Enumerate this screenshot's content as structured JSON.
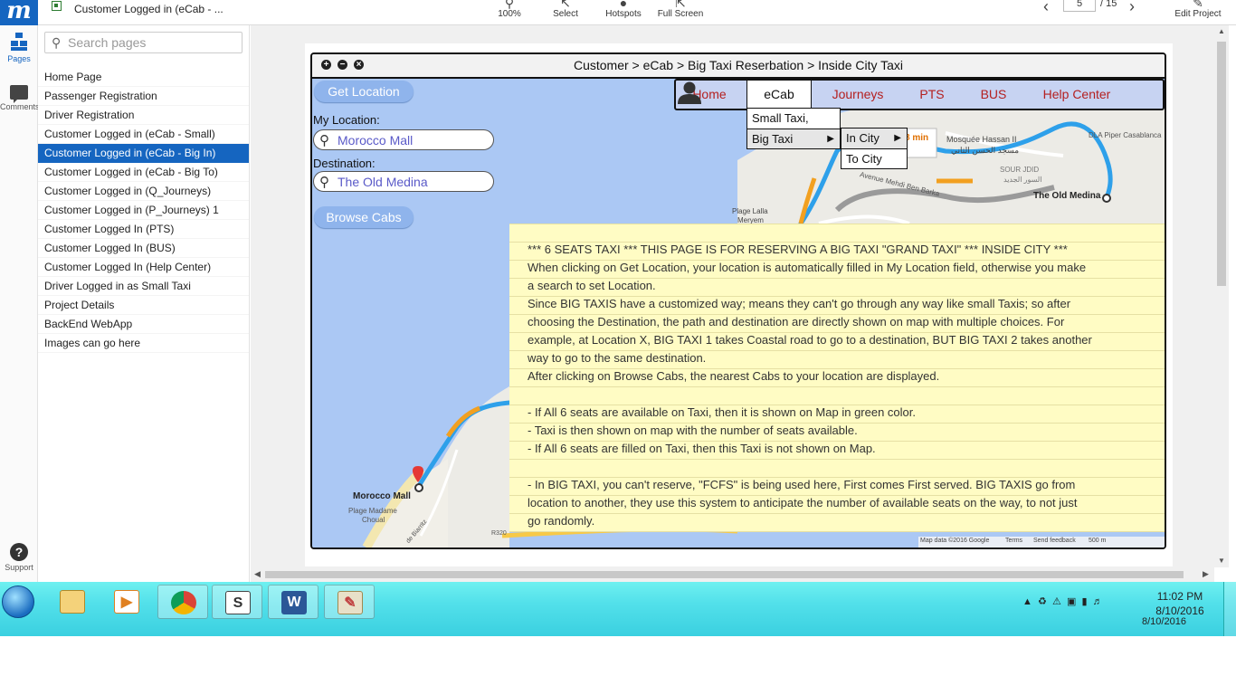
{
  "topbar": {
    "logo": "m",
    "doc_title": "Customer Logged in (eCab - ...",
    "tools": [
      {
        "label": "100%",
        "icon": "zoom-icon"
      },
      {
        "label": "Select",
        "icon": "cursor-icon"
      },
      {
        "label": "Hotspots",
        "icon": "hotspot-icon"
      },
      {
        "label": "Full Screen",
        "icon": "fullscreen-icon"
      }
    ],
    "page_current": "5",
    "page_total": "/ 15",
    "edit_project": "Edit Project"
  },
  "rail": {
    "pages": "Pages",
    "comments": "Comments",
    "support": "Support"
  },
  "panel": {
    "search_placeholder": "Search pages",
    "pages": [
      "Home Page",
      "Passenger Registration",
      "Driver Registration",
      "Customer Logged in (eCab - Small)",
      "Customer Logged in (eCab - Big In)",
      "Customer Logged in (eCab - Big To)",
      "Customer Logged in (Q_Journeys)",
      "Customer Logged in (P_Journeys) 1",
      "Customer Logged In (PTS)",
      "Customer Logged In (BUS)",
      "Customer Logged In (Help Center)",
      "Driver Logged in as Small Taxi",
      "Project Details",
      "BackEnd WebApp",
      "Images can go here"
    ],
    "active_index": 4
  },
  "mockup": {
    "breadcrumb": "Customer > eCab > Big Taxi Reserbation > Inside City Taxi",
    "get_location": "Get Location",
    "my_location_label": "My Location:",
    "my_location_value": "Morocco Mall",
    "destination_label": "Destination:",
    "destination_value": "The Old Medina",
    "browse_cabs": "Browse Cabs",
    "nav": [
      "Home",
      "eCab",
      "Journeys",
      "PTS",
      "BUS",
      "Help Center"
    ],
    "nav_active": "eCab",
    "dropdown": {
      "small_taxi": "Small Taxi,",
      "big_taxi": "Big Taxi",
      "in_city": "In City",
      "to_city": "To City"
    },
    "map_labels": {
      "morocco_mall": "Morocco Mall",
      "old_medina": "The Old Medina",
      "mosquee": "Mosquée Hassan II",
      "mosquee_ar": "مسجد الحسن الثاني",
      "sour_jdid": "SOUR JDID",
      "sour_jdid_ar": "السور الجديد",
      "avenue": "Avenue Mehdi Ben Barka",
      "plage_lalla": "Plage Lalla",
      "plage_lalla2": "Meryem",
      "plage_madame": "Plage Madame",
      "plage_madame2": "Choual",
      "dla": "DLA Piper Casablanca",
      "biarritz": "de Biarritz",
      "r320": "R320",
      "eta_min": "8 min",
      "footer_mapdata": "Map data ©2016 Google",
      "footer_terms": "Terms",
      "footer_feedback": "Send feedback",
      "footer_scale": "500 m"
    },
    "note_lines": [
      "*** 6 SEATS TAXI *** THIS PAGE IS FOR RESERVING A BIG TAXI \"GRAND TAXI\" *** INSIDE CITY ***",
      "When clicking on Get Location, your location is automatically filled in My Location field, otherwise you make",
      "a search to set Location.",
      "Since BIG TAXIS have a customized way; means they can't go through any way like small Taxis; so after",
      "choosing the Destination, the path and destination are directly shown on map with multiple choices. For",
      "example, at Location X, BIG TAXI 1 takes Coastal road to go to a destination, BUT BIG TAXI 2 takes another",
      "way to go to the same destination.",
      "After clicking on Browse Cabs, the nearest Cabs to your location are displayed.",
      "",
      "- If All 6 seats are available on Taxi, then it is shown on Map in green color.",
      "- Taxi is then shown on map with the number of seats available.",
      "- If All 6 seats are filled on Taxi, then this Taxi is not shown on Map.",
      "",
      "- In BIG TAXI, you can't reserve, \"FCFS\" is being used here, First comes First served. BIG TAXIS go from",
      "location to another, they use this system to anticipate the number of available seats on the way, to not just",
      "go randomly."
    ]
  },
  "taskbar": {
    "time": "11:02 PM",
    "date": "8/10/2016",
    "date_ghost": "8/10/2016"
  },
  "colors": {
    "brand": "#1565c0",
    "nav_text": "#b42020",
    "note_bg": "#fffcc4",
    "route": "#2ea0ea",
    "route_alt": "#f2a020"
  }
}
